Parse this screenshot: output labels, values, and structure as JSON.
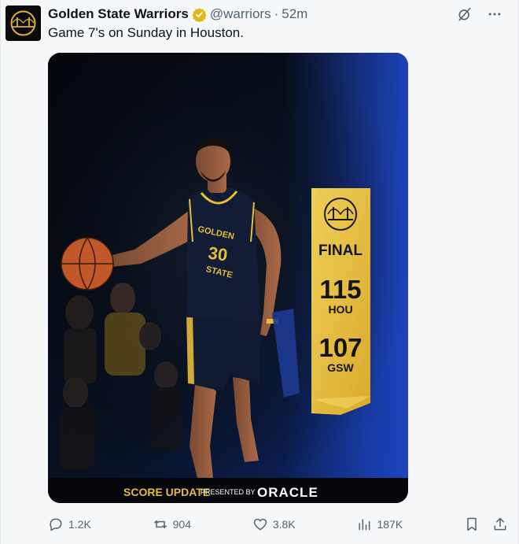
{
  "account": {
    "display_name": "Golden State Warriors",
    "handle": "@warriors",
    "separator": "·",
    "time": "52m",
    "avatar_icon": "warriors-bridge-logo"
  },
  "post": {
    "text": "Game 7's on Sunday in Houston."
  },
  "graphic": {
    "status": "FINAL",
    "team1_score": "115",
    "team1_abbr": "HOU",
    "team2_score": "107",
    "team2_abbr": "GSW",
    "jersey_line1": "GOLDEN",
    "jersey_number": "30",
    "jersey_line2": "STATE",
    "footer_left": "SCORE UPDATE",
    "footer_presented": "PRESENTED BY",
    "footer_sponsor": "ORACLE",
    "colors": {
      "gold": "#e4bd3b",
      "navy": "#0d1a33",
      "blue": "#1f48c9"
    }
  },
  "actions": {
    "replies": "1.2K",
    "reposts": "904",
    "likes": "3.8K",
    "views": "187K"
  },
  "icons": {
    "grok": "grok-icon",
    "more": "more-icon",
    "reply": "reply-icon",
    "repost": "repost-icon",
    "like": "heart-icon",
    "views": "views-icon",
    "bookmark": "bookmark-icon",
    "share": "share-icon"
  }
}
